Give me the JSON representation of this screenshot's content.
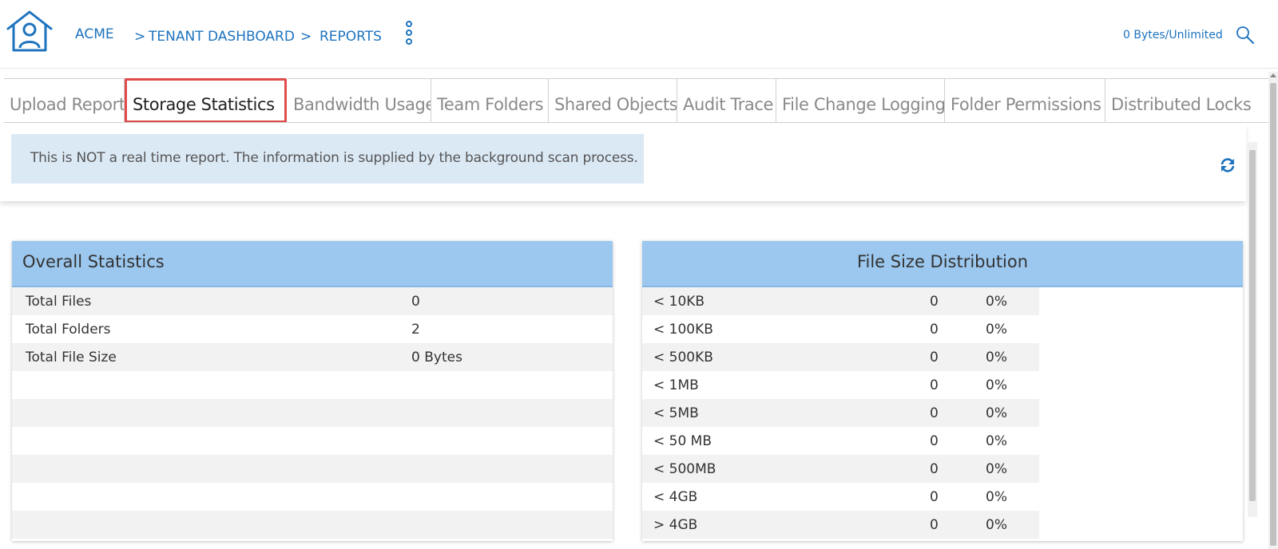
{
  "header": {
    "home_icon": "home-user-icon",
    "breadcrumb": {
      "root": "ACME",
      "sep": ">",
      "tenant": "TENANT DASHBOARD",
      "current": "REPORTS"
    },
    "quota": "0 Bytes/Unlimited",
    "search_icon": "search-icon",
    "accent": "#1e73be"
  },
  "tabs": [
    {
      "label": "Upload Report"
    },
    {
      "label": "Storage Statistics",
      "active": true
    },
    {
      "label": "Bandwidth Usage"
    },
    {
      "label": "Team Folders"
    },
    {
      "label": "Shared Objects"
    },
    {
      "label": "Audit Trace"
    },
    {
      "label": "File Change Logging"
    },
    {
      "label": "Folder Permissions"
    },
    {
      "label": "Distributed Locks"
    }
  ],
  "notice": {
    "text": "This is NOT a real time report. The information is supplied by the background scan process.",
    "refresh_icon": "refresh-icon"
  },
  "overall": {
    "title": "Overall Statistics",
    "rows": [
      {
        "label": "Total Files",
        "value": "0"
      },
      {
        "label": "Total Folders",
        "value": "2"
      },
      {
        "label": "Total File Size",
        "value": "0 Bytes"
      }
    ]
  },
  "distribution": {
    "title": "File Size Distribution",
    "rows": [
      {
        "label": "< 10KB",
        "count": "0",
        "percent": "0%"
      },
      {
        "label": "< 100KB",
        "count": "0",
        "percent": "0%"
      },
      {
        "label": "< 500KB",
        "count": "0",
        "percent": "0%"
      },
      {
        "label": "< 1MB",
        "count": "0",
        "percent": "0%"
      },
      {
        "label": "< 5MB",
        "count": "0",
        "percent": "0%"
      },
      {
        "label": "< 50 MB",
        "count": "0",
        "percent": "0%"
      },
      {
        "label": "< 500MB",
        "count": "0",
        "percent": "0%"
      },
      {
        "label": "< 4GB",
        "count": "0",
        "percent": "0%"
      },
      {
        "label": "> 4GB",
        "count": "0",
        "percent": "0%"
      }
    ]
  },
  "colors": {
    "panel_header": "#9cc8ef",
    "notice_bg": "#dbe9f5",
    "active_tab_border": "#e04b4b"
  }
}
